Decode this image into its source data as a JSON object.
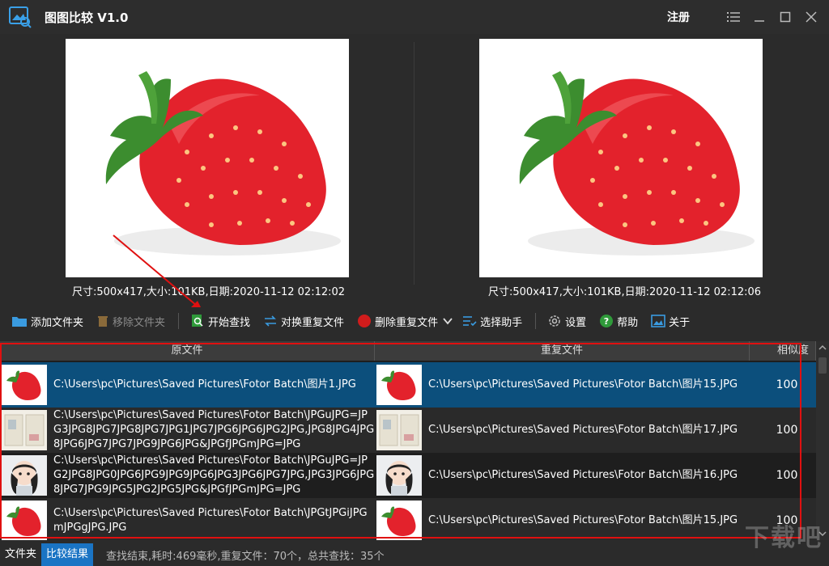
{
  "app": {
    "title": "图图比较 V1.0",
    "register_label": "注册"
  },
  "preview": {
    "left_info": "尺寸:500x417,大小:101KB,日期:2020-11-12 02:12:02",
    "right_info": "尺寸:500x417,大小:101KB,日期:2020-11-12 02:12:06"
  },
  "toolbar": {
    "add_folder": "添加文件夹",
    "remove_folder": "移除文件夹",
    "start_search": "开始查找",
    "swap_duplicates": "对换重复文件",
    "delete_duplicates": "删除重复文件",
    "select_helper": "选择助手",
    "settings": "设置",
    "help": "帮助",
    "about": "关于"
  },
  "table": {
    "headers": {
      "source": "原文件",
      "duplicate": "重复文件",
      "similarity": "相似度"
    },
    "rows": [
      {
        "source": "C:\\Users\\pc\\Pictures\\Saved Pictures\\Fotor Batch\\图片1.JPG",
        "duplicate": "C:\\Users\\pc\\Pictures\\Saved Pictures\\Fotor Batch\\图片15.JPG",
        "similarity": "100",
        "thumb": "strawberry"
      },
      {
        "source": "C:\\Users\\pc\\Pictures\\Saved Pictures\\Fotor Batch\\JPGuJPG=JPG3JPG8JPG7JPG8JPG7JPG1JPG7JPG6JPG6JPG2JPG,JPG8JPG4JPG8JPG6JPG7JPG7JPG9JPG6JPG&JPGfJPGmJPG=JPG",
        "duplicate": "C:\\Users\\pc\\Pictures\\Saved Pictures\\Fotor Batch\\图片17.JPG",
        "similarity": "100",
        "thumb": "document"
      },
      {
        "source": "C:\\Users\\pc\\Pictures\\Saved Pictures\\Fotor Batch\\JPGuJPG=JPG2JPG8JPG0JPG6JPG9JPG9JPG6JPG3JPG6JPG7JPG,JPG3JPG6JPG8JPG7JPG9JPG5JPG2JPG5JPG&JPGfJPGmJPG=JPG",
        "duplicate": "C:\\Users\\pc\\Pictures\\Saved Pictures\\Fotor Batch\\图片16.JPG",
        "similarity": "100",
        "thumb": "cartoon"
      },
      {
        "source": "C:\\Users\\pc\\Pictures\\Saved Pictures\\Fotor Batch\\JPGtJPGiJPGmJPGgJPG.JPG",
        "duplicate": "C:\\Users\\pc\\Pictures\\Saved Pictures\\Fotor Batch\\图片15.JPG",
        "similarity": "100",
        "thumb": "strawberry"
      }
    ]
  },
  "status": {
    "tab_folder": "文件夹",
    "tab_results": "比较结果",
    "text": "查找结束,耗时:469毫秒,重复文件：70个，总共查找：35个"
  },
  "watermark": "下载吧",
  "colors": {
    "selected_row": "#0c4f7c",
    "accent": "#1a74c4",
    "highlight_box": "#e01010"
  }
}
